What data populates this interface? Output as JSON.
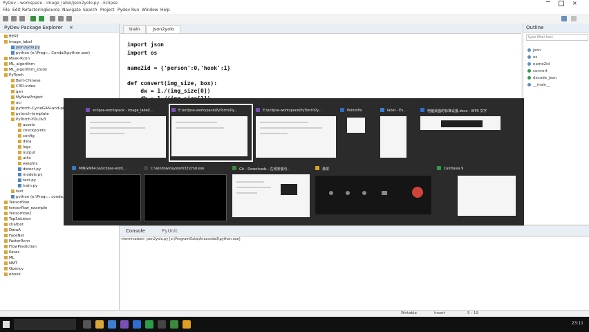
{
  "window": {
    "title": "PyDev - workspace - image_label/json2yolo.py - Eclipse"
  },
  "menu": [
    "File",
    "Edit",
    "Refactoring",
    "Source",
    "Navigate",
    "Search",
    "Project",
    "Pydev",
    "Run",
    "Window",
    "Help"
  ],
  "explorer": {
    "title": "PyDev Package Explorer",
    "items": [
      "BERT",
      "image_label",
      "json2yolo.py",
      "python (e:\\Progr... Conda3\\python.exe)",
      "Mask-Rcnn",
      "ML_algorithm",
      "ML_algorithm_study",
      "PyTorch",
      "Bert-Chinese",
      "C3D-video",
      "gan",
      "MyNewProject",
      "ocr",
      "pytorch-CycleGAN-and-pix2pix",
      "pytorch-template",
      "PyTorch-YOLOv3",
      "assets",
      "checkpoints",
      "config",
      "data",
      "logs",
      "output",
      "utils",
      "weights",
      "detect.py",
      "models.py",
      "test.py",
      "train.py",
      "test",
      "python (e:\\Progr... conda...)",
      "Tensorflow",
      "tensorflow_example",
      "Tensorflow2",
      "TopSolution",
      "chatbot",
      "DataA",
      "FaceNet",
      "FasterRcnn",
      "FlowPrediction",
      "Keras",
      "ML",
      "NMT",
      "Opencv",
      "ebook"
    ]
  },
  "editor": {
    "tabs": [
      "train",
      "json2yolo"
    ],
    "code": [
      "import json",
      "import os",
      "",
      "name2id = {'person':0,'hook':1}",
      "",
      "def convert(img_size, box):",
      "    dw = 1./(img_size[0])",
      "    dh = 1./(img_size[1])"
    ]
  },
  "outline": {
    "title": "Outline",
    "filter_placeholder": "type filter text",
    "items": [
      "json",
      "os",
      "name2id",
      "convert",
      "decode_json",
      "__main__"
    ]
  },
  "console": {
    "tabs": [
      "Console",
      "PyUnit"
    ],
    "line": "<terminated> json2yolo.py [e:\\ProgramData\\Anaconda3\\python.exe]"
  },
  "statusbar": {
    "left": "Writable",
    "mid": "Insert",
    "pos": "5 : 19"
  },
  "switcher": {
    "row1": [
      {
        "label": "eclipse-workspace - image_label/...",
        "color": "#7a4fb8"
      },
      {
        "label": "E:\\eclipse-workspace\\PyTorch\\Py...",
        "color": "#7a4fb8"
      },
      {
        "label": "E:\\eclipse-workspace\\PyTorch\\Py...",
        "color": "#7a4fb8"
      },
      {
        "label": "Pointofix",
        "color": "#2c6fbf"
      },
      {
        "label": "label - Ex...",
        "color": "#3c7fd0"
      },
      {
        "label": "电脑桌面的标准设置.docx - WPS 文字",
        "color": "#2f6ed1"
      }
    ],
    "row2": [
      {
        "label": "MINGW64:/e/eclipse-work...",
        "color": "#3b78c4"
      },
      {
        "label": "C:\\windows\\system32\\cmd.exe",
        "color": "#444"
      },
      {
        "label": "Git - Downloads - 在线安装与..",
        "color": "#3b8a3b"
      },
      {
        "label": "录屏",
        "color": "#e0a020"
      },
      {
        "label": "Camtasia 9",
        "color": "#2a9d4a"
      }
    ]
  },
  "taskbar": {
    "clock": "23:11"
  }
}
